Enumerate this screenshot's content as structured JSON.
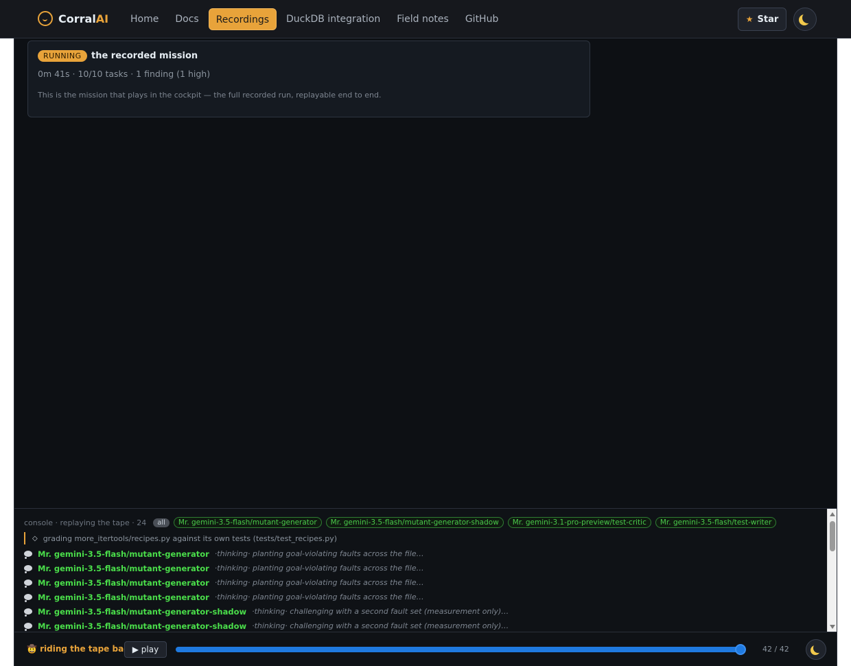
{
  "brand": {
    "name_main": "Corral",
    "name_accent": "AI"
  },
  "nav": {
    "items": [
      {
        "label": "Home",
        "active": false
      },
      {
        "label": "Docs",
        "active": false
      },
      {
        "label": "Recordings",
        "active": true
      },
      {
        "label": "DuckDB integration",
        "active": false
      },
      {
        "label": "Field notes",
        "active": false
      },
      {
        "label": "GitHub",
        "active": false
      }
    ],
    "star_label": "Star"
  },
  "mission": {
    "status": "RUNNING",
    "title": "the recorded mission",
    "meta": "0m 41s · 10/10 tasks · 1 finding (1 high)",
    "description": "This is the mission that plays in the cockpit — the full recorded run, replayable end to end."
  },
  "console": {
    "label": "console · replaying the tape · 24",
    "filter_all": "all",
    "filters": [
      "Mr. gemini-3.5-flash/mutant-generator",
      "Mr. gemini-3.5-flash/mutant-generator-shadow",
      "Mr. gemini-3.1-pro-preview/test-critic",
      "Mr. gemini-3.5-flash/test-writer"
    ],
    "grading": "grading more_itertools/recipes.py against its own tests (tests/test_recipes.py)",
    "lines": [
      {
        "agent": "Mr. gemini-3.5-flash/mutant-generator",
        "msg": "·thinking· planting goal-violating faults across the file…"
      },
      {
        "agent": "Mr. gemini-3.5-flash/mutant-generator",
        "msg": "·thinking· planting goal-violating faults across the file…"
      },
      {
        "agent": "Mr. gemini-3.5-flash/mutant-generator",
        "msg": "·thinking· planting goal-violating faults across the file…"
      },
      {
        "agent": "Mr. gemini-3.5-flash/mutant-generator",
        "msg": "·thinking· planting goal-violating faults across the file…"
      },
      {
        "agent": "Mr. gemini-3.5-flash/mutant-generator-shadow",
        "msg": "·thinking· challenging with a second fault set (measurement only)…"
      },
      {
        "agent": "Mr. gemini-3.5-flash/mutant-generator-shadow",
        "msg": "·thinking· challenging with a second fault set (measurement only)…"
      }
    ]
  },
  "playback": {
    "label": "🤠 riding the tape back",
    "play_label": "▶ play",
    "position": 42,
    "total": 42,
    "counter": "42 / 42"
  },
  "colors": {
    "accent": "#e8a33a",
    "agent_green": "#4ade4a",
    "progress_blue": "#1f7ae0",
    "background": "#0d1014"
  }
}
